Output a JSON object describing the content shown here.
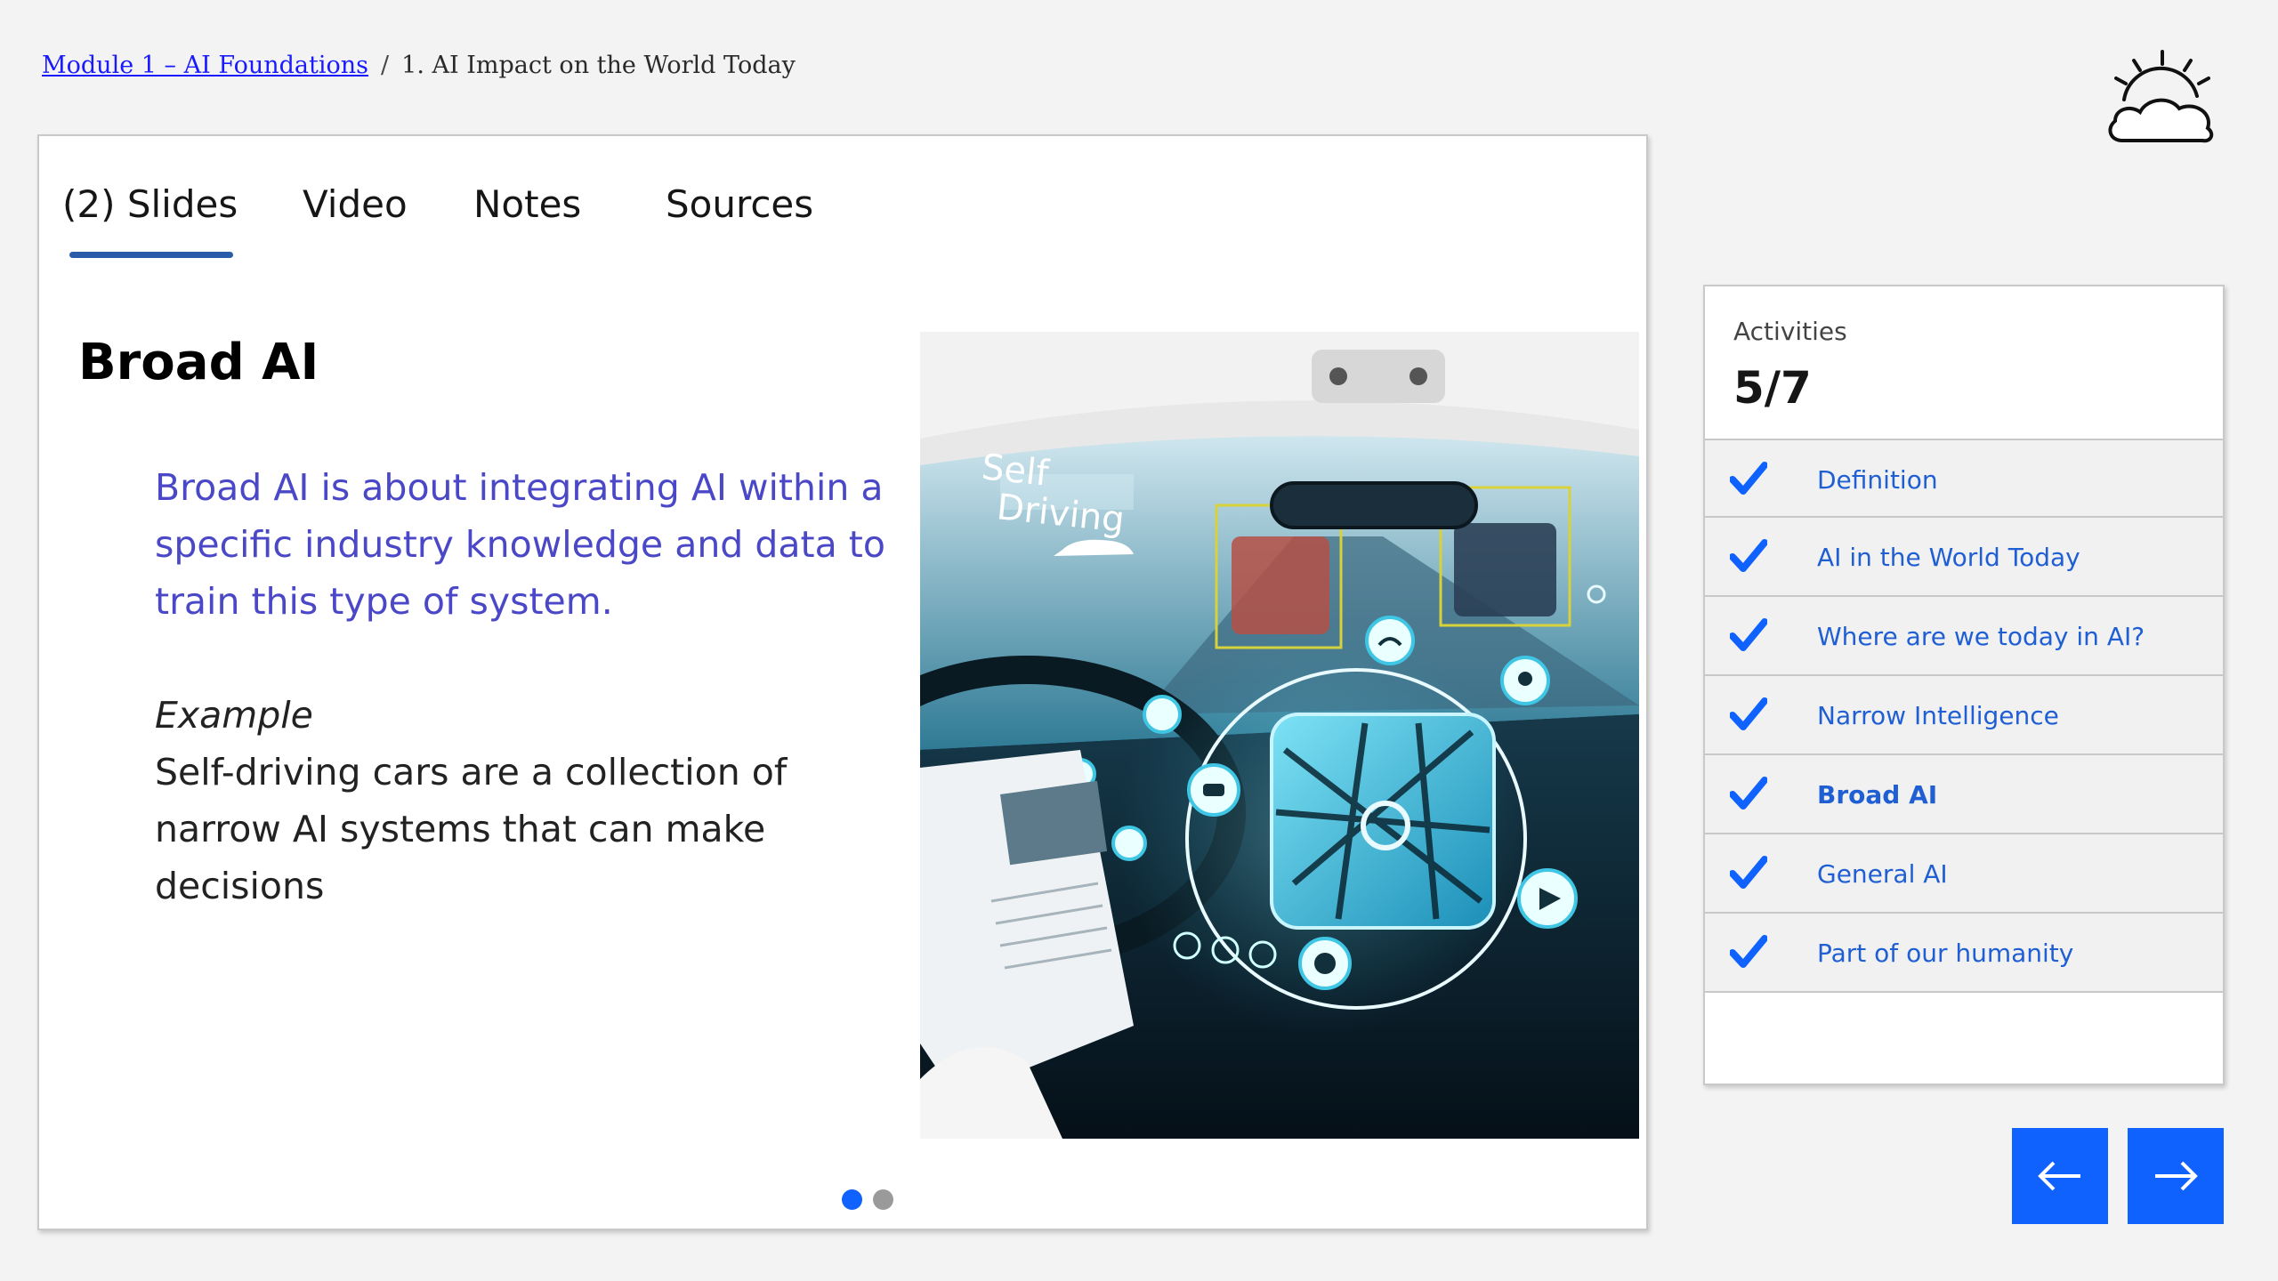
{
  "breadcrumb": {
    "module_link": "Module 1 – AI Foundations",
    "separator": "/",
    "current": "1. AI Impact on the World Today"
  },
  "tabs": [
    {
      "label": "(2) Slides",
      "selected": true
    },
    {
      "label": "Video"
    },
    {
      "label": "Notes"
    },
    {
      "label": "Sources"
    }
  ],
  "slide": {
    "title": "Broad AI",
    "lead": "Broad AI is about integrating AI within a specific industry knowledge and data to train this type of system.",
    "example_label": "Example",
    "example_body": "Self-driving cars are a collection of narrow AI systems that can make decisions",
    "image": {
      "overlay_text_line1": "Self",
      "overlay_text_line2": "Driving"
    },
    "pagination": {
      "current": 1,
      "total": 2
    }
  },
  "activities": {
    "label": "Activities",
    "count": "5/7",
    "items": [
      {
        "label": "Definition",
        "done": true
      },
      {
        "label": "AI in the World Today",
        "done": true
      },
      {
        "label": "Where are we today in AI?",
        "done": true
      },
      {
        "label": "Narrow Intelligence",
        "done": true
      },
      {
        "label": "Broad AI",
        "done": true,
        "current": true
      },
      {
        "label": "General AI",
        "done": true
      },
      {
        "label": "Part of our humanity",
        "done": true
      }
    ]
  },
  "navigation": {
    "prev_icon": "arrow-left-icon",
    "next_icon": "arrow-right-icon"
  },
  "colors": {
    "accent": "#0f62fe",
    "tab_underline": "#2a5caa",
    "lead_text": "#4b48c8",
    "activity_link": "#1f5fd3",
    "page_bg": "#f3f3f3"
  }
}
